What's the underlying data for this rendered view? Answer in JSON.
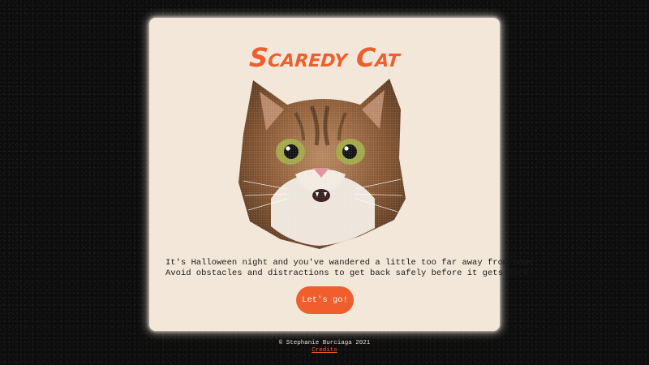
{
  "game": {
    "title": "Scaredy Cat",
    "intro_line1": "It's Halloween night and you've wandered a little too far away from home.",
    "intro_line2": "Avoid obstacles and distractions to get back safely before it gets dark!",
    "start_label": "Let's go!"
  },
  "footer": {
    "copyright": "© Stephanie Burciaga 2021",
    "credits_label": "Credits"
  },
  "colors": {
    "accent": "#ef5f2e",
    "card": "#f3e7da",
    "background": "#0d0d0d"
  },
  "icons": {
    "hero_image": "scared-cat-face"
  }
}
